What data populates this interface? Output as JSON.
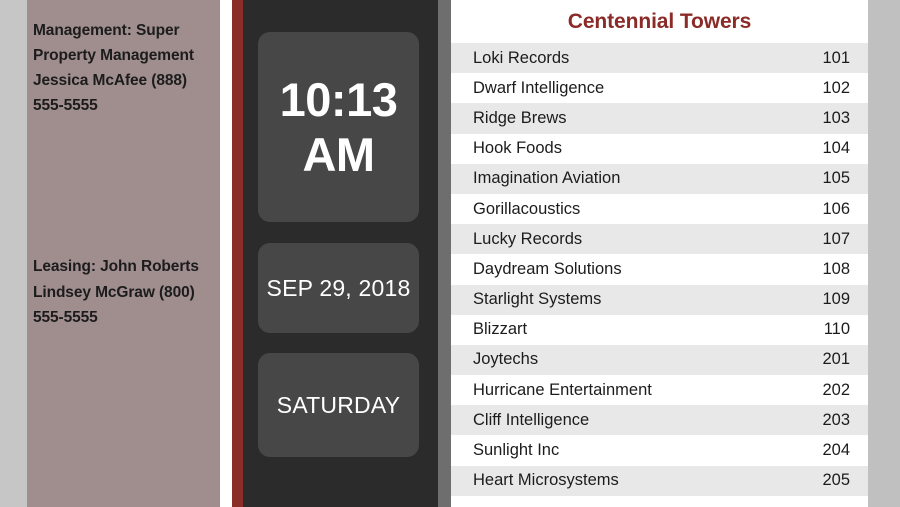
{
  "sidebar": {
    "management": {
      "lines": "Management: Super Property Management Jessica McAfee (888) 555-5555"
    },
    "leasing": {
      "lines": "Leasing: John Roberts Lindsey McGraw (800) 555-5555"
    }
  },
  "clock": {
    "time": "10:13 AM",
    "date": "SEP 29, 2018",
    "day": "SATURDAY"
  },
  "directory": {
    "title": "Centennial Towers",
    "entries": [
      {
        "name": "Loki Records",
        "suite": "101"
      },
      {
        "name": "Dwarf Intelligence",
        "suite": "102"
      },
      {
        "name": "Ridge Brews",
        "suite": "103"
      },
      {
        "name": "Hook Foods",
        "suite": "104"
      },
      {
        "name": "Imagination Aviation",
        "suite": "105"
      },
      {
        "name": "Gorillacoustics",
        "suite": "106"
      },
      {
        "name": "Lucky Records",
        "suite": "107"
      },
      {
        "name": "Daydream Solutions",
        "suite": "108"
      },
      {
        "name": "Starlight Systems",
        "suite": "109"
      },
      {
        "name": "Blizzart",
        "suite": "110"
      },
      {
        "name": "Joytechs",
        "suite": "201"
      },
      {
        "name": "Hurricane Entertainment",
        "suite": "202"
      },
      {
        "name": "Cliff Intelligence",
        "suite": "203"
      },
      {
        "name": "Sunlight Inc",
        "suite": "204"
      },
      {
        "name": "Heart Microsystems",
        "suite": "205"
      }
    ]
  },
  "colors": {
    "sidebar_bg": "#a08e8e",
    "accent_stripe": "#8a2e27",
    "title_text": "#8b2b28",
    "panel_bg": "#2b2b2b",
    "card_bg": "#474747",
    "row_alt_bg": "#e8e8e8",
    "page_bg": "#c6c6c6"
  }
}
